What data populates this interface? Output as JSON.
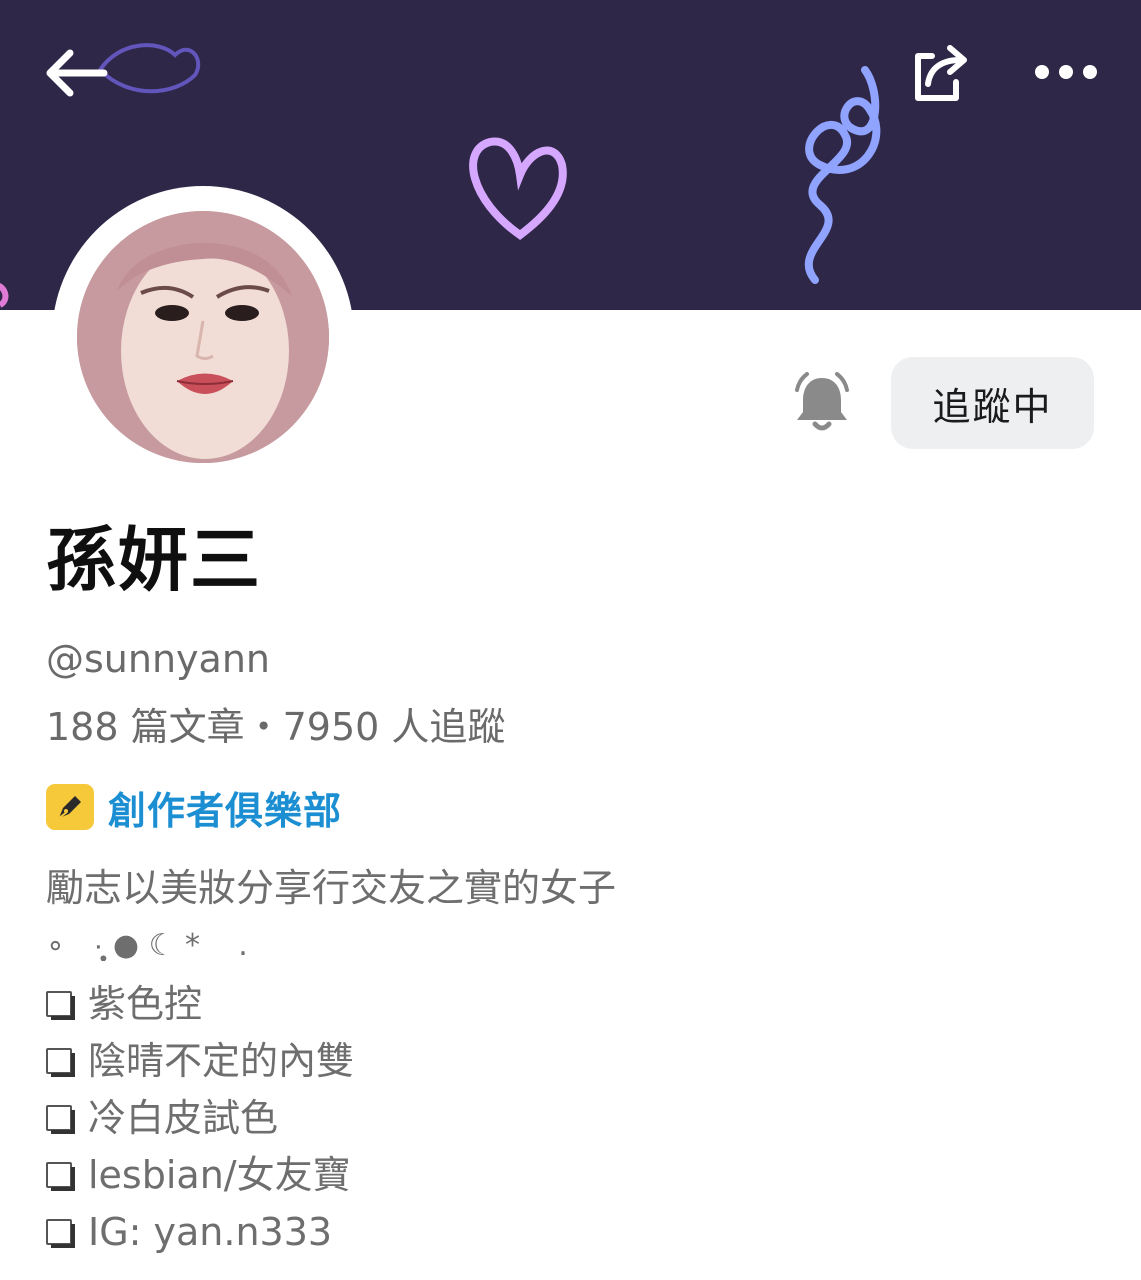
{
  "header": {
    "back_icon": "arrow-left-icon",
    "share_icon": "share-icon",
    "more_icon": "more-dots-icon"
  },
  "profile": {
    "name": "孫妍三",
    "handle": "@sunnyann",
    "stats": "188 篇文章・7950 人追蹤",
    "badge_label": "創作者俱樂部",
    "bell_icon": "bell-icon",
    "follow_label": "追蹤中"
  },
  "bio": {
    "line1": "勵志以美妝分享行交友之實的女子",
    "line2": "∘   ·̩̩̥͙ ● ☾ *    .",
    "items": [
      {
        "label": "紫色控"
      },
      {
        "label": "陰晴不定的內雙"
      },
      {
        "label": "冷白皮試色"
      },
      {
        "label": "lesbian/女友寶"
      },
      {
        "label": "IG: yan.n333"
      }
    ]
  },
  "colors": {
    "banner": "#2e2747",
    "badge_yellow": "#f5c93a",
    "badge_text": "#1c8fd3",
    "follow_bg": "#eeeff1"
  }
}
